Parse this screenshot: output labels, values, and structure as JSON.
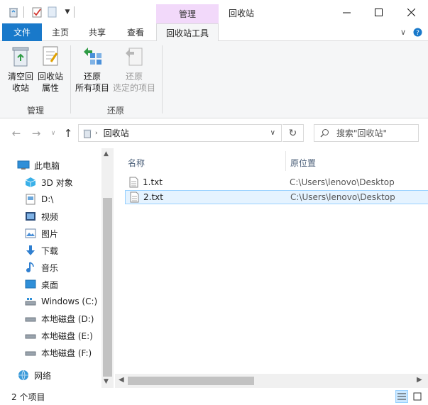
{
  "window": {
    "title": "回收站",
    "context_tab_header": "管理"
  },
  "ribbon_tabs": {
    "file": "文件",
    "home": "主页",
    "share": "共享",
    "view": "查看",
    "recycle_tools": "回收站工具"
  },
  "ribbon": {
    "empty_recycle_bin": [
      "清空回",
      "收站"
    ],
    "properties": [
      "回收站",
      "属性"
    ],
    "restore_all": [
      "还原",
      "所有项目"
    ],
    "restore_selected": [
      "还原",
      "选定的项目"
    ],
    "group_manage": "管理",
    "group_restore": "还原"
  },
  "address": {
    "path": "回收站",
    "search_placeholder": "搜索\"回收站\""
  },
  "nav_pane": {
    "items": [
      {
        "label": "此电脑",
        "icon": "pc-icon"
      },
      {
        "label": "3D 对象",
        "icon": "3d-objects-icon"
      },
      {
        "label": "D:\\",
        "icon": "drive-document-icon"
      },
      {
        "label": "视频",
        "icon": "video-folder-icon"
      },
      {
        "label": "图片",
        "icon": "picture-folder-icon"
      },
      {
        "label": "下载",
        "icon": "download-icon"
      },
      {
        "label": "音乐",
        "icon": "music-icon"
      },
      {
        "label": "桌面",
        "icon": "desktop-icon"
      },
      {
        "label": "Windows (C:)",
        "icon": "windows-drive-icon"
      },
      {
        "label": "本地磁盘 (D:)",
        "icon": "local-disk-icon"
      },
      {
        "label": "本地磁盘 (E:)",
        "icon": "local-disk-icon"
      },
      {
        "label": "本地磁盘 (F:)",
        "icon": "local-disk-icon"
      },
      {
        "label": "网络",
        "icon": "network-icon"
      }
    ]
  },
  "file_list": {
    "columns": {
      "name": "名称",
      "original_location": "原位置"
    },
    "rows": [
      {
        "name": "1.txt",
        "location": "C:\\Users\\lenovo\\Desktop",
        "selected": false
      },
      {
        "name": "2.txt",
        "location": "C:\\Users\\lenovo\\Desktop",
        "selected": true
      }
    ]
  },
  "status_bar": {
    "item_count": "2 个项目"
  },
  "colors": {
    "file_tab": "#1979ca",
    "context_tab": "#f2d9fa",
    "selection_bg": "#e5f3ff",
    "selection_border": "#99d1ff"
  }
}
